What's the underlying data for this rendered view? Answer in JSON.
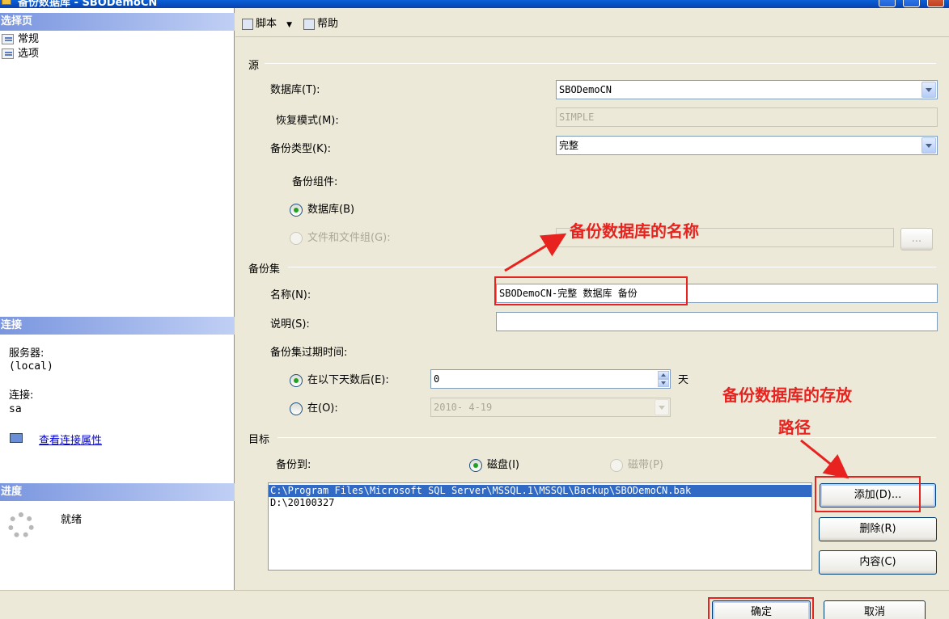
{
  "window": {
    "title": "备份数据库 - SBODemoCN"
  },
  "left": {
    "select_page_header": "选择页",
    "pages": [
      {
        "label": "常规"
      },
      {
        "label": "选项"
      }
    ],
    "connection_header": "连接",
    "server_label": "服务器:",
    "server_value": "(local)",
    "connection_label": "连接:",
    "connection_value": "sa",
    "view_connection_link": "查看连接属性",
    "progress_header": "进度",
    "progress_status": "就绪"
  },
  "toolbar": {
    "script_label": "脚本",
    "help_label": "帮助"
  },
  "source": {
    "group_label": "源",
    "database_label": "数据库(T):",
    "database_value": "SBODemoCN",
    "recovery_label": "恢复模式(M):",
    "recovery_value": "SIMPLE",
    "backup_type_label": "备份类型(K):",
    "backup_type_value": "完整",
    "component_label": "备份组件:",
    "radio_database": "数据库(B)",
    "radio_files": "文件和文件组(G):",
    "browse_label": "..."
  },
  "backup_set": {
    "group_label": "备份集",
    "name_label": "名称(N):",
    "name_value": "SBODemoCN-完整 数据库 备份",
    "description_label": "说明(S):",
    "description_value": "",
    "expire_label": "备份集过期时间:",
    "radio_after_days": "在以下天数后(E):",
    "days_value": "0",
    "days_unit": "天",
    "radio_on": "在(O):",
    "date_value": "2010- 4-19"
  },
  "destination": {
    "group_label": "目标",
    "backup_to_label": "备份到:",
    "radio_disk": "磁盘(I)",
    "radio_tape": "磁带(P)",
    "paths": [
      "C:\\Program Files\\Microsoft SQL Server\\MSSQL.1\\MSSQL\\Backup\\SBODemoCN.bak",
      "D:\\20100327"
    ],
    "add_button": "添加(D)...",
    "remove_button": "删除(R)",
    "contents_button": "内容(C)"
  },
  "footer": {
    "ok_button": "确定",
    "cancel_button": "取消"
  },
  "annotations": {
    "name_note": "备份数据库的名称",
    "path_note_line1": "备份数据库的存放",
    "path_note_line2": "路径",
    "color": "#e8231f"
  }
}
